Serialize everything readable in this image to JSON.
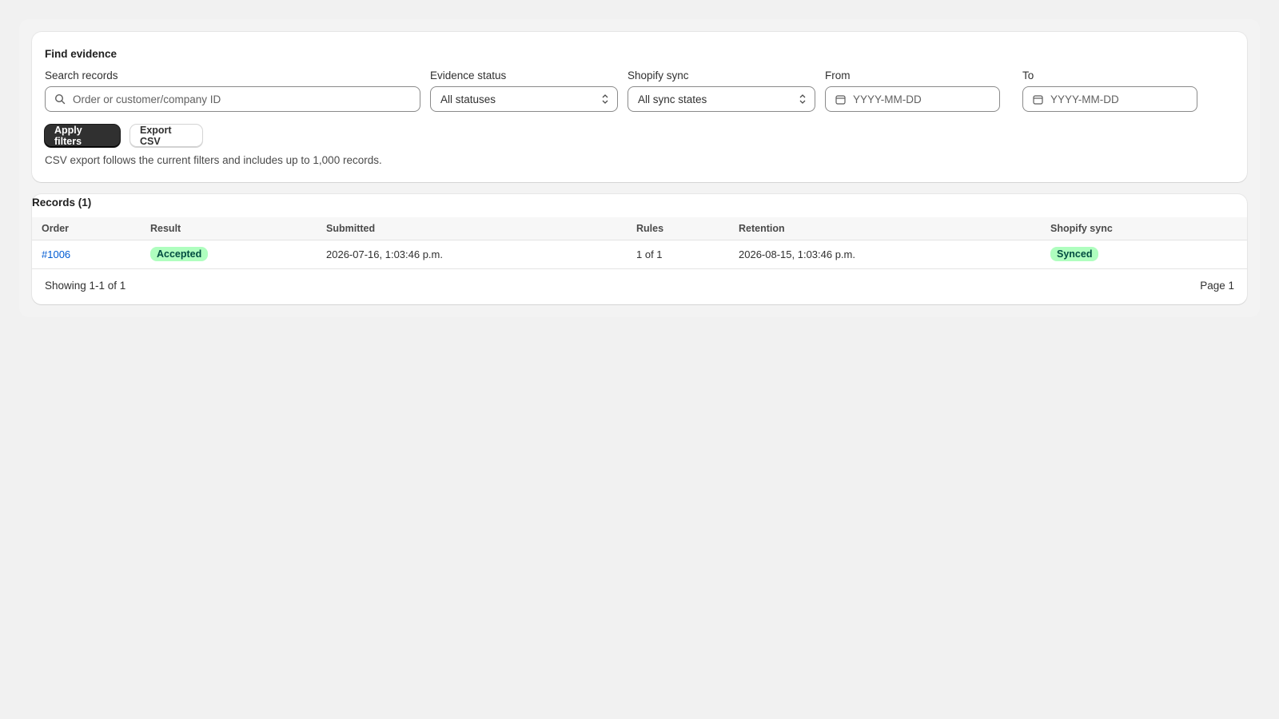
{
  "filters": {
    "title": "Find evidence",
    "search": {
      "label": "Search records",
      "placeholder": "Order or customer/company ID",
      "icon": "search-icon"
    },
    "evidence_status": {
      "label": "Evidence status",
      "value": "All statuses"
    },
    "shopify_sync": {
      "label": "Shopify sync",
      "value": "All sync states"
    },
    "from": {
      "label": "From",
      "placeholder": "YYYY-MM-DD",
      "icon": "calendar-icon"
    },
    "to": {
      "label": "To",
      "placeholder": "YYYY-MM-DD",
      "icon": "calendar-icon"
    },
    "apply_label": "Apply filters",
    "export_label": "Export CSV",
    "help_text": "CSV export follows the current filters and includes up to 1,000 records."
  },
  "records": {
    "title": "Records (1)",
    "columns": [
      "Order",
      "Result",
      "Submitted",
      "Rules",
      "Retention",
      "Shopify sync"
    ],
    "rows": [
      {
        "order": "#1006",
        "result": "Accepted",
        "submitted": "2026-07-16, 1:03:46 p.m.",
        "rules": "1 of 1",
        "retention": "2026-08-15, 1:03:46 p.m.",
        "sync": "Synced"
      }
    ],
    "showing": "Showing 1-1 of 1",
    "page": "Page 1"
  },
  "colors": {
    "primary_button": "#303030",
    "link": "#005bd3",
    "success_badge_bg": "#affebf",
    "success_badge_text": "#014b40"
  }
}
